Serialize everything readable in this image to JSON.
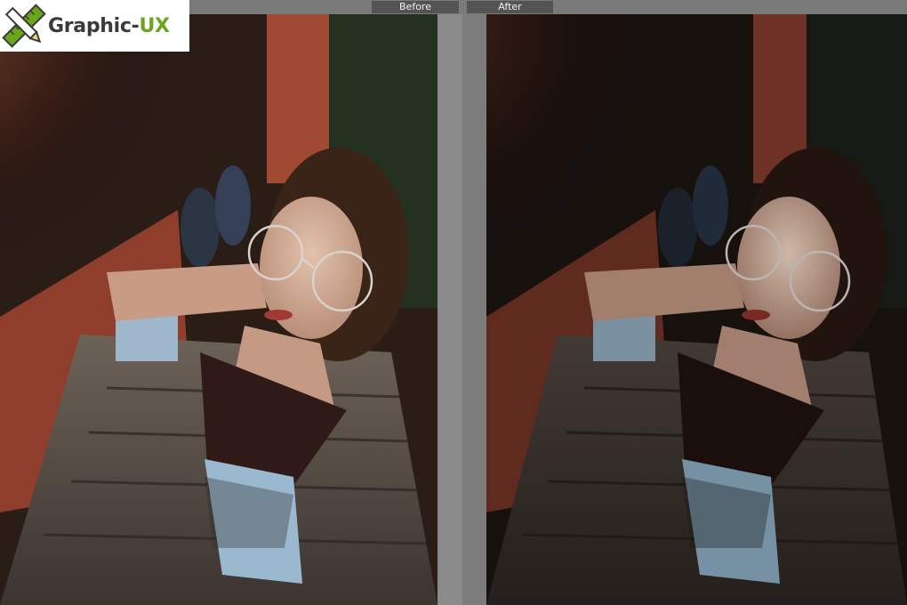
{
  "toolbar": {
    "before_label": "Before",
    "after_label": "After"
  },
  "logo": {
    "text_main": "Graphic-",
    "text_accent": "UX",
    "brand_green": "#6aa51b",
    "icon": "pencil-ruler-icon"
  },
  "panels": {
    "before": {
      "tone": "warm-original"
    },
    "after": {
      "tone": "dark-moody-edit"
    }
  }
}
